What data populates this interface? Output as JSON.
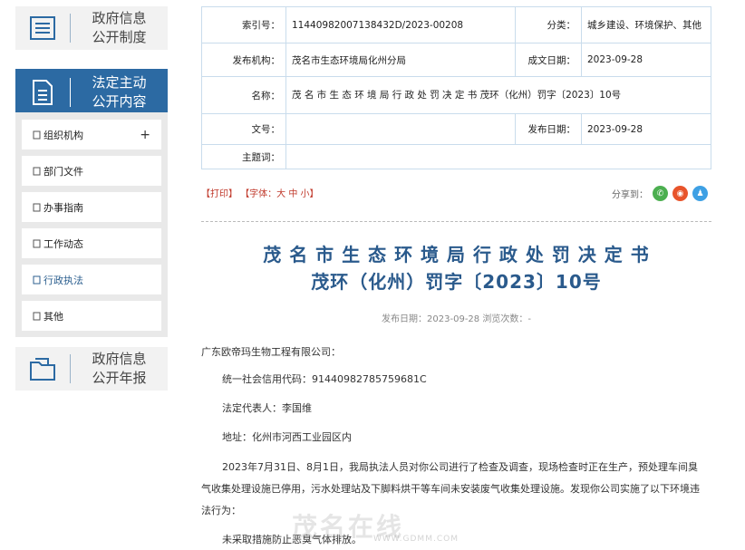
{
  "sidebar": {
    "cards": [
      {
        "line1": "政府信息",
        "line2": "公开制度"
      },
      {
        "line1": "法定主动",
        "line2": "公开内容"
      },
      {
        "line1": "政府信息",
        "line2": "公开年报"
      }
    ],
    "items": [
      "组织机构",
      "部门文件",
      "办事指南",
      "工作动态",
      "行政执法",
      "其他"
    ],
    "plus": "+"
  },
  "meta": {
    "index_label": "索引号：",
    "index_value": "11440982007138432D/2023-00208",
    "category_label": "分类：",
    "category_value": "城乡建设、环境保护、其他",
    "publisher_label": "发布机构：",
    "publisher_value": "茂名市生态环境局化州分局",
    "date_label": "成文日期：",
    "date_value": "2023-09-28",
    "name_label": "名称：",
    "name_value": "茂 名 市 生 态 环 境 局 行 政 处 罚 决 定 书 茂环（化州）罚字〔2023〕10号",
    "docno_label": "文号：",
    "docno_value": "",
    "pubdate_label": "发布日期：",
    "pubdate_value": "2023-09-28",
    "keywords_label": "主题词：",
    "keywords_value": ""
  },
  "toolbar": {
    "print": "【打印】",
    "font": "【字体：大 中 小】",
    "share_label": "分享到："
  },
  "article": {
    "title_line1": "茂 名 市 生 态 环 境 局 行 政 处 罚 决 定 书",
    "title_line2": "茂环（化州）罚字〔2023〕10号",
    "pubinfo": "发布日期：2023-09-28  浏览次数：-",
    "paragraphs": [
      "广东欧帝玛生物工程有限公司：",
      "统一社会信用代码：91440982785759681C",
      "法定代表人：李国维",
      "地址：化州市河西工业园区内",
      "2023年7月31日、8月1日，我局执法人员对你公司进行了检查及调查，现场检查时正在生产，预处理车间臭",
      "气收集处理设施已停用，污水处理站及下脚料烘干等车间未安装废气收集处理设施。发现你公司实施了以下环境违",
      "法行为：",
      "未采取措施防止恶臭气体排放。"
    ]
  },
  "watermark": {
    "text": "茂名在线",
    "url": "WWW.GDMM.COM"
  },
  "colors": {
    "accent": "#2c6aa3",
    "title": "#2a5a8c",
    "table_border": "#c9dcec"
  }
}
